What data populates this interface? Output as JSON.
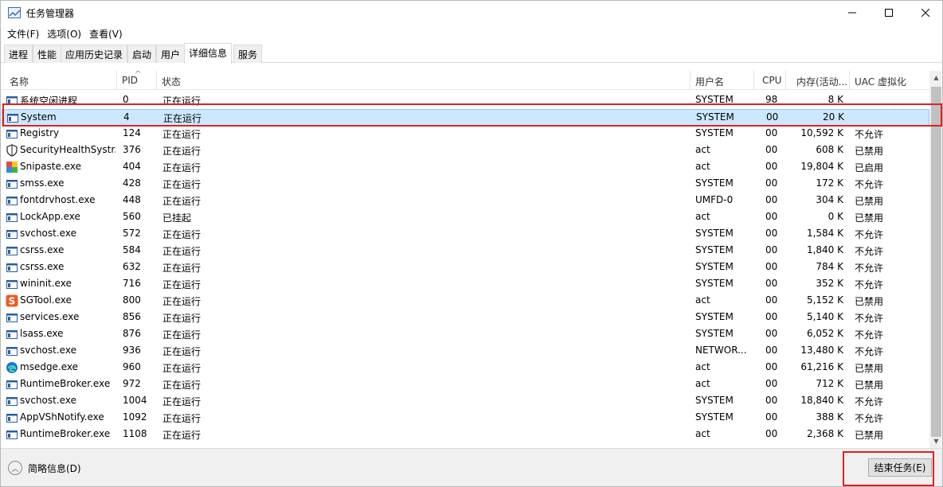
{
  "window": {
    "title": "任务管理器"
  },
  "menu": [
    "文件(F)",
    "选项(O)",
    "查看(V)"
  ],
  "tabs": [
    {
      "label": "进程",
      "active": false
    },
    {
      "label": "性能",
      "active": false
    },
    {
      "label": "应用历史记录",
      "active": false
    },
    {
      "label": "启动",
      "active": false
    },
    {
      "label": "用户",
      "active": false
    },
    {
      "label": "详细信息",
      "active": true
    },
    {
      "label": "服务",
      "active": false
    }
  ],
  "columns": [
    "名称",
    "PID",
    "状态",
    "用户名",
    "CPU",
    "内存(活动...",
    "UAC 虚拟化"
  ],
  "rows": [
    {
      "icon": "generic-process-icon",
      "name": "系统空闲进程",
      "pid": "0",
      "status": "正在运行",
      "user": "SYSTEM",
      "cpu": "98",
      "mem": "8 K",
      "uac": ""
    },
    {
      "icon": "generic-process-icon",
      "name": "System",
      "pid": "4",
      "status": "正在运行",
      "user": "SYSTEM",
      "cpu": "00",
      "mem": "20 K",
      "uac": "",
      "selected": true
    },
    {
      "icon": "generic-process-icon",
      "name": "Registry",
      "pid": "124",
      "status": "正在运行",
      "user": "SYSTEM",
      "cpu": "00",
      "mem": "10,592 K",
      "uac": "不允许"
    },
    {
      "icon": "shield-icon",
      "name": "SecurityHealthSystr...",
      "pid": "376",
      "status": "正在运行",
      "user": "act",
      "cpu": "00",
      "mem": "608 K",
      "uac": "已禁用"
    },
    {
      "icon": "snipaste-icon",
      "name": "Snipaste.exe",
      "pid": "404",
      "status": "正在运行",
      "user": "act",
      "cpu": "00",
      "mem": "19,804 K",
      "uac": "已启用"
    },
    {
      "icon": "generic-process-icon",
      "name": "smss.exe",
      "pid": "428",
      "status": "正在运行",
      "user": "SYSTEM",
      "cpu": "00",
      "mem": "172 K",
      "uac": "不允许"
    },
    {
      "icon": "generic-process-icon",
      "name": "fontdrvhost.exe",
      "pid": "448",
      "status": "正在运行",
      "user": "UMFD-0",
      "cpu": "00",
      "mem": "304 K",
      "uac": "已禁用"
    },
    {
      "icon": "generic-process-icon",
      "name": "LockApp.exe",
      "pid": "560",
      "status": "已挂起",
      "user": "act",
      "cpu": "00",
      "mem": "0 K",
      "uac": "已禁用"
    },
    {
      "icon": "generic-process-icon",
      "name": "svchost.exe",
      "pid": "572",
      "status": "正在运行",
      "user": "SYSTEM",
      "cpu": "00",
      "mem": "1,584 K",
      "uac": "不允许"
    },
    {
      "icon": "generic-process-icon",
      "name": "csrss.exe",
      "pid": "584",
      "status": "正在运行",
      "user": "SYSTEM",
      "cpu": "00",
      "mem": "1,840 K",
      "uac": "不允许"
    },
    {
      "icon": "generic-process-icon",
      "name": "csrss.exe",
      "pid": "632",
      "status": "正在运行",
      "user": "SYSTEM",
      "cpu": "00",
      "mem": "784 K",
      "uac": "不允许"
    },
    {
      "icon": "generic-process-icon",
      "name": "wininit.exe",
      "pid": "716",
      "status": "正在运行",
      "user": "SYSTEM",
      "cpu": "00",
      "mem": "352 K",
      "uac": "不允许"
    },
    {
      "icon": "sgtool-icon",
      "name": "SGTool.exe",
      "pid": "800",
      "status": "正在运行",
      "user": "act",
      "cpu": "00",
      "mem": "5,152 K",
      "uac": "已禁用"
    },
    {
      "icon": "generic-process-icon",
      "name": "services.exe",
      "pid": "856",
      "status": "正在运行",
      "user": "SYSTEM",
      "cpu": "00",
      "mem": "5,140 K",
      "uac": "不允许"
    },
    {
      "icon": "generic-process-icon",
      "name": "lsass.exe",
      "pid": "876",
      "status": "正在运行",
      "user": "SYSTEM",
      "cpu": "00",
      "mem": "6,052 K",
      "uac": "不允许"
    },
    {
      "icon": "generic-process-icon",
      "name": "svchost.exe",
      "pid": "936",
      "status": "正在运行",
      "user": "NETWOR...",
      "cpu": "00",
      "mem": "13,480 K",
      "uac": "不允许"
    },
    {
      "icon": "edge-icon",
      "name": "msedge.exe",
      "pid": "960",
      "status": "正在运行",
      "user": "act",
      "cpu": "00",
      "mem": "61,216 K",
      "uac": "已禁用"
    },
    {
      "icon": "generic-process-icon",
      "name": "RuntimeBroker.exe",
      "pid": "972",
      "status": "正在运行",
      "user": "act",
      "cpu": "00",
      "mem": "712 K",
      "uac": "已禁用"
    },
    {
      "icon": "generic-process-icon",
      "name": "svchost.exe",
      "pid": "1004",
      "status": "正在运行",
      "user": "SYSTEM",
      "cpu": "00",
      "mem": "18,840 K",
      "uac": "不允许"
    },
    {
      "icon": "generic-process-icon",
      "name": "AppVShNotify.exe",
      "pid": "1092",
      "status": "正在运行",
      "user": "SYSTEM",
      "cpu": "00",
      "mem": "388 K",
      "uac": "不允许"
    },
    {
      "icon": "generic-process-icon",
      "name": "RuntimeBroker.exe",
      "pid": "1108",
      "status": "正在运行",
      "user": "act",
      "cpu": "00",
      "mem": "2,368 K",
      "uac": "已禁用"
    }
  ],
  "footer": {
    "fewer_details": "简略信息(D)",
    "end_task": "结束任务(E)"
  },
  "colors": {
    "selection": "#cce8ff",
    "highlight": "#e02020",
    "edge_blue": "#0f78d4",
    "sgtool_orange": "#f05a22"
  }
}
